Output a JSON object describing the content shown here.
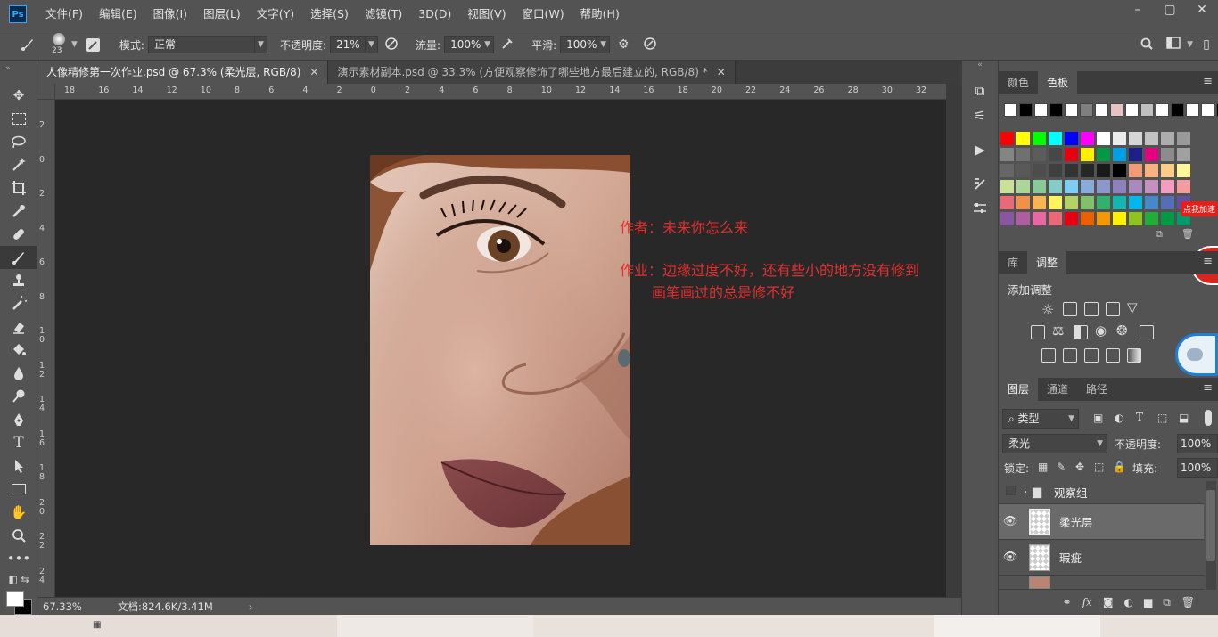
{
  "app": {
    "logo": "Ps"
  },
  "menubar": {
    "items": [
      "文件(F)",
      "编辑(E)",
      "图像(I)",
      "图层(L)",
      "文字(Y)",
      "选择(S)",
      "滤镜(T)",
      "3D(D)",
      "视图(V)",
      "窗口(W)",
      "帮助(H)"
    ]
  },
  "window_controls": {
    "minimize": "–",
    "restore": "▢",
    "close": "✕"
  },
  "options": {
    "brush_size": "23",
    "mode_label": "模式:",
    "mode_value": "正常",
    "opacity_label": "不透明度:",
    "opacity_value": "21%",
    "flow_label": "流量:",
    "flow_value": "100%",
    "smooth_label": "平滑:",
    "smooth_value": "100%"
  },
  "tabs": [
    {
      "label": "人像精修第一次作业.psd @ 67.3% (柔光层, RGB/8)",
      "active": true
    },
    {
      "label": "演示素材副本.psd @ 33.3% (方便观察修饰了哪些地方最后建立的, RGB/8) *",
      "active": false
    }
  ],
  "ruler_top": [
    "18",
    "16",
    "14",
    "12",
    "10",
    "8",
    "6",
    "4",
    "2",
    "0",
    "2",
    "4",
    "6",
    "8",
    "10",
    "12",
    "14",
    "16",
    "18",
    "20",
    "22",
    "24",
    "26",
    "28",
    "30",
    "32"
  ],
  "ruler_left": [
    "2",
    "0",
    "2",
    "4",
    "6",
    "8",
    "10",
    "12",
    "14",
    "16",
    "18",
    "20",
    "22",
    "24"
  ],
  "canvas": {
    "note_author": "作者：未来你怎么来",
    "note_homework": "作业：边缘过度不好，还有些小的地方没有修到",
    "note_homework_2": "画笔画过的总是修不好"
  },
  "status": {
    "zoom": "67.33%",
    "doc_info": "文档:824.6K/3.41M",
    "arrow": "›"
  },
  "swatch_panel": {
    "tabs": [
      "颜色",
      "色板"
    ],
    "active_tab": "色板",
    "recent_colors": [
      "#ffffff",
      "#000000",
      "#ffffff",
      "#000000",
      "#ffffff",
      "#7f7f7f",
      "#ffffff",
      "#e6c3c3",
      "#ffffff",
      "#c0c0c0",
      "#ffffff",
      "#000000",
      "#ffffff",
      "#ffffff",
      "#000000"
    ],
    "rows": [
      [
        "#ff0000",
        "#ffff00",
        "#00ff00",
        "#00ffff",
        "#0000ff",
        "#ff00ff",
        "#ffffff",
        "#ebebeb",
        "#d6d6d6",
        "#c2c2c2",
        "#adadad",
        "#999999"
      ],
      [
        "#858585",
        "#707070",
        "#5c5c5c",
        "#474747",
        "#e60012",
        "#fff100",
        "#009944",
        "#00a0e9",
        "#1d2088",
        "#e4007f",
        "#8c8c8c",
        "#a0a0a0"
      ],
      [
        "#666666",
        "#595959",
        "#4d4d4d",
        "#404040",
        "#333333",
        "#262626",
        "#1a1a1a",
        "#000000",
        "#f29b76",
        "#f6b37f",
        "#facd89",
        "#fff799"
      ],
      [
        "#cce198",
        "#acd598",
        "#89c997",
        "#84ccc9",
        "#7ecef4",
        "#88abda",
        "#8c97cb",
        "#8f82bc",
        "#aa89bd",
        "#c490bf",
        "#f19ec2",
        "#f29c9f"
      ],
      [
        "#eb6877",
        "#f19149",
        "#f8b551",
        "#fff45c",
        "#b3d465",
        "#80c269",
        "#32b16c",
        "#13b5b1",
        "#00b7ee",
        "#448aca",
        "#556fb5",
        "#5f52a0"
      ],
      [
        "#8957a1",
        "#ae5da1",
        "#ea68a2",
        "#eb6877",
        "#e60012",
        "#eb6100",
        "#f39800",
        "#fff100",
        "#8fc31f",
        "#22ac38",
        "#009944",
        "#009b6b"
      ]
    ],
    "badge_text": "点我加速",
    "badge_number": "98"
  },
  "adjust_panel": {
    "tabs": [
      "库",
      "调整"
    ],
    "active_tab": "调整",
    "title": "添加调整"
  },
  "layers_panel": {
    "tabs": [
      "图层",
      "通道",
      "路径"
    ],
    "active_tab": "图层",
    "filter_label": "类型",
    "blend_mode": "柔光",
    "opacity_label": "不透明度:",
    "opacity_value": "100%",
    "lock_label": "锁定:",
    "fill_label": "填充:",
    "fill_value": "100%",
    "layers": [
      {
        "name": "观察组",
        "type": "group",
        "visible": false
      },
      {
        "name": "柔光层",
        "type": "layer",
        "visible": true,
        "selected": true
      },
      {
        "name": "瑕疵",
        "type": "layer",
        "visible": true,
        "selected": false
      }
    ],
    "fx_label": "fx"
  }
}
